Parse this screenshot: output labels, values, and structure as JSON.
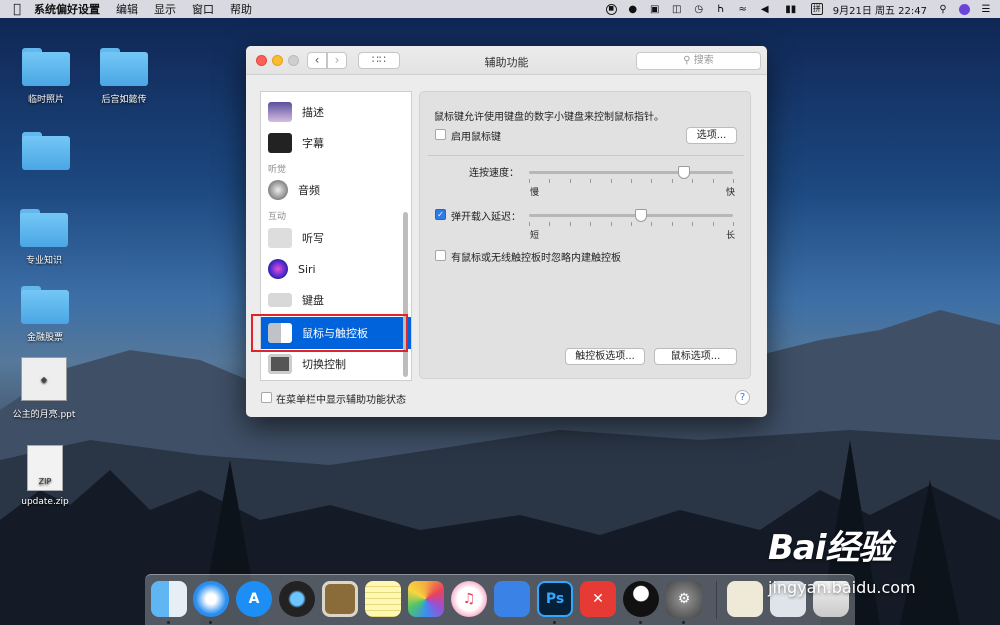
{
  "menubar": {
    "app_name": "系统偏好设置",
    "items": [
      "编辑",
      "显示",
      "窗口",
      "帮助"
    ],
    "datetime": "9月21日 周五  22:47",
    "ime": "拼",
    "right_icons": [
      "record-icon",
      "qq-icon",
      "cast-icon",
      "display-icon",
      "time-machine-icon",
      "bluetooth-icon",
      "wifi-icon",
      "volume-icon",
      "battery-icon",
      "ime-icon",
      "search-icon",
      "siri-icon",
      "list-icon"
    ]
  },
  "desktop": {
    "icons": [
      {
        "label": "临时照片",
        "kind": "folder"
      },
      {
        "label": "后宫如懿传",
        "kind": "folder"
      },
      {
        "label": "",
        "kind": "folder"
      },
      {
        "label": "专业知识",
        "kind": "folder"
      },
      {
        "label": "金融股票",
        "kind": "folder"
      },
      {
        "label": "公主的月亮.ppt",
        "kind": "ppt"
      },
      {
        "label": "update.zip",
        "kind": "zip",
        "badge": "ZIP"
      }
    ]
  },
  "window": {
    "title": "辅助功能",
    "search_placeholder": "搜索",
    "sidebar": {
      "items": [
        {
          "label": "描述"
        },
        {
          "label": "字幕"
        },
        {
          "label": "音频"
        },
        {
          "label": "听写"
        },
        {
          "label": "Siri"
        },
        {
          "label": "键盘"
        },
        {
          "label": "鼠标与触控板",
          "selected": true
        },
        {
          "label": "切换控制"
        }
      ],
      "headers": [
        "听觉",
        "互动"
      ]
    },
    "pane": {
      "description": "鼠标键允许使用键盘的数字小键盘来控制鼠标指针。",
      "enable_mouse_keys": {
        "label": "启用鼠标键",
        "checked": false
      },
      "options_button": "选项...",
      "double_click_speed": {
        "label": "连按速度：",
        "min_label": "慢",
        "max_label": "快",
        "value": 0.76
      },
      "spring_loading": {
        "label": "弹开载入延迟：",
        "checked": true,
        "min_label": "短",
        "max_label": "长",
        "value": 0.55
      },
      "ignore_builtin": {
        "label": "有鼠标或无线触控板时忽略内建触控板",
        "checked": false
      },
      "trackpad_options_button": "触控板选项...",
      "mouse_options_button": "鼠标选项..."
    },
    "show_in_menubar": {
      "label": "在菜单栏中显示辅助功能状态",
      "checked": false
    },
    "help_label": "?"
  },
  "dock": {
    "apps": [
      "Finder",
      "Safari",
      "App Store",
      "QuickTime Player",
      "Preview",
      "Notes",
      "Photos",
      "iTunes",
      "Keynote",
      "Photoshop",
      "XMind",
      "QQ",
      "System Preferences",
      "Documents",
      "Files",
      "Trash"
    ],
    "ps_label": "Ps"
  },
  "watermark": {
    "text": "Bai经验",
    "url": "jingyan.baidu.com"
  },
  "colors": {
    "selection": "#0063dc",
    "highlight_box": "#e0242a",
    "checkbox_on": "#2f7ae5"
  }
}
